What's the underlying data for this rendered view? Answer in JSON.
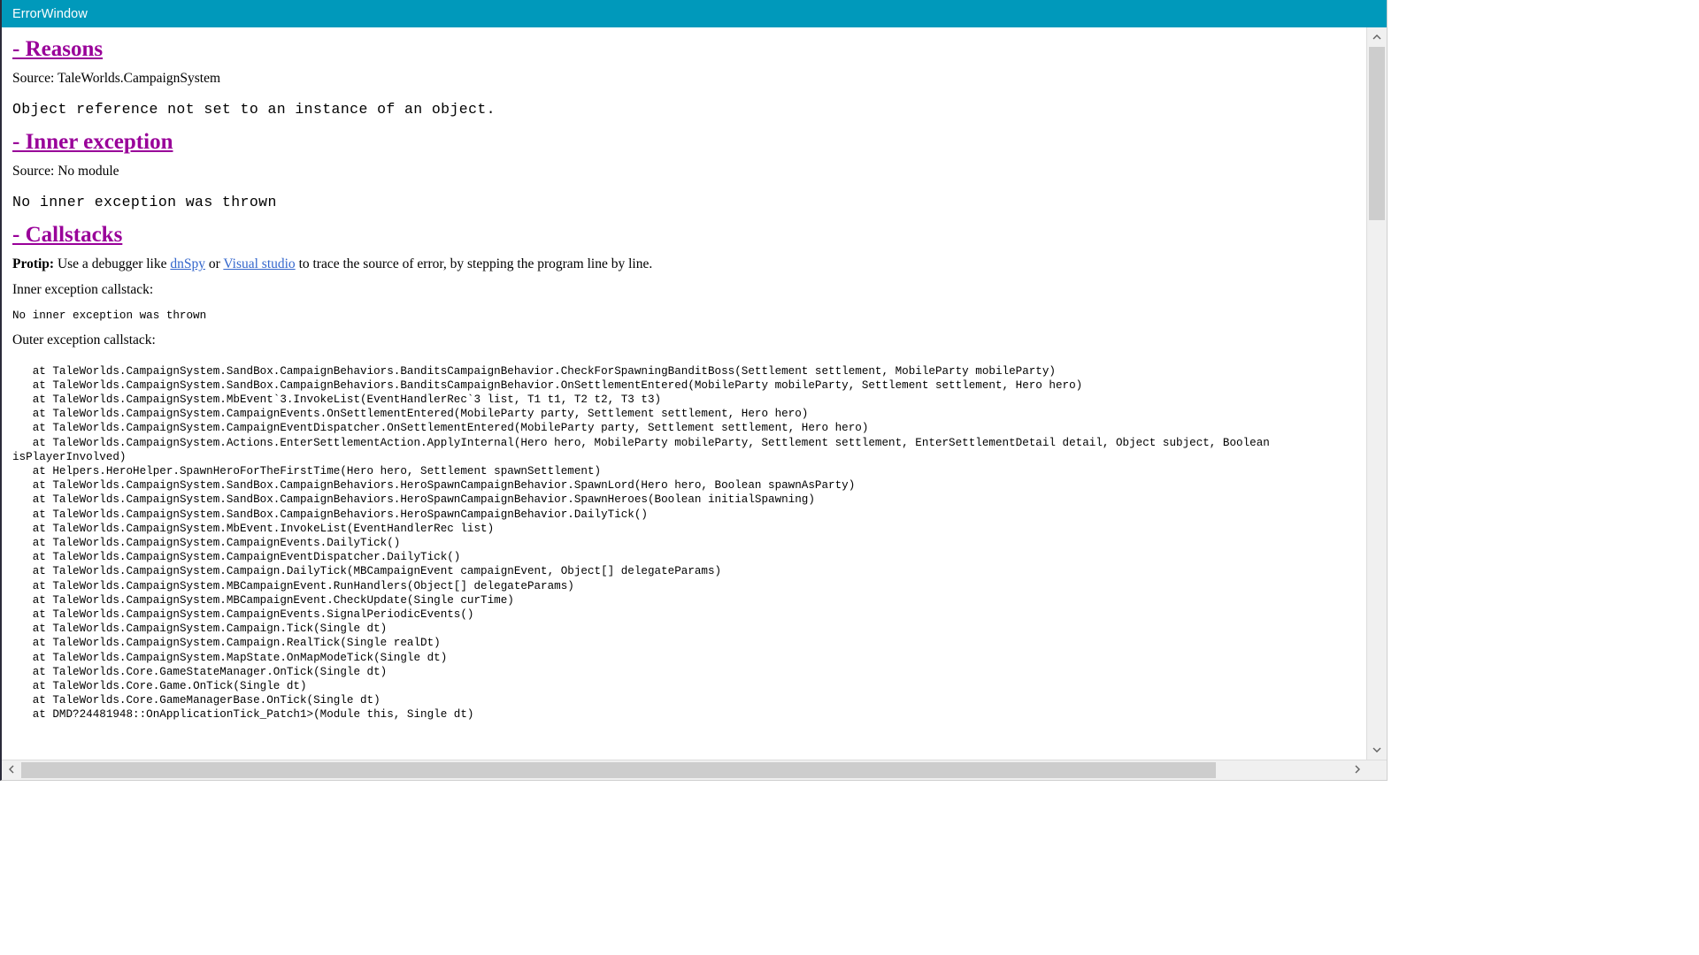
{
  "window": {
    "title": "ErrorWindow",
    "titlebar_color": "#0099bb",
    "heading_color": "#990099",
    "link_color": "#3366cc"
  },
  "sections": {
    "reasons": {
      "heading": "- Reasons",
      "source_line": "Source: TaleWorlds.CampaignSystem",
      "message": "Object reference not set to an instance of an object."
    },
    "inner_exception": {
      "heading": "- Inner exception",
      "source_line": "Source: No module",
      "message": "No inner exception was thrown"
    },
    "callstacks": {
      "heading": "- Callstacks",
      "protip_label": "Protip:",
      "protip_before": " Use a debugger like ",
      "link_dnspy": "dnSpy",
      "protip_or": " or ",
      "link_visual_studio": "Visual studio",
      "protip_after": " to trace the source of error, by stepping the program line by line.",
      "inner_label": "Inner exception callstack:",
      "inner_stack": "No inner exception was thrown",
      "outer_label": "Outer exception callstack:",
      "outer_stack_lines": [
        "   at TaleWorlds.CampaignSystem.SandBox.CampaignBehaviors.BanditsCampaignBehavior.CheckForSpawningBanditBoss(Settlement settlement, MobileParty mobileParty)",
        "   at TaleWorlds.CampaignSystem.SandBox.CampaignBehaviors.BanditsCampaignBehavior.OnSettlementEntered(MobileParty mobileParty, Settlement settlement, Hero hero)",
        "   at TaleWorlds.CampaignSystem.MbEvent`3.InvokeList(EventHandlerRec`3 list, T1 t1, T2 t2, T3 t3)",
        "   at TaleWorlds.CampaignSystem.CampaignEvents.OnSettlementEntered(MobileParty party, Settlement settlement, Hero hero)",
        "   at TaleWorlds.CampaignSystem.CampaignEventDispatcher.OnSettlementEntered(MobileParty party, Settlement settlement, Hero hero)",
        "   at TaleWorlds.CampaignSystem.Actions.EnterSettlementAction.ApplyInternal(Hero hero, MobileParty mobileParty, Settlement settlement, EnterSettlementDetail detail, Object subject, Boolean isPlayerInvolved)",
        "   at Helpers.HeroHelper.SpawnHeroForTheFirstTime(Hero hero, Settlement spawnSettlement)",
        "   at TaleWorlds.CampaignSystem.SandBox.CampaignBehaviors.HeroSpawnCampaignBehavior.SpawnLord(Hero hero, Boolean spawnAsParty)",
        "   at TaleWorlds.CampaignSystem.SandBox.CampaignBehaviors.HeroSpawnCampaignBehavior.SpawnHeroes(Boolean initialSpawning)",
        "   at TaleWorlds.CampaignSystem.SandBox.CampaignBehaviors.HeroSpawnCampaignBehavior.DailyTick()",
        "   at TaleWorlds.CampaignSystem.MbEvent.InvokeList(EventHandlerRec list)",
        "   at TaleWorlds.CampaignSystem.CampaignEvents.DailyTick()",
        "   at TaleWorlds.CampaignSystem.CampaignEventDispatcher.DailyTick()",
        "   at TaleWorlds.CampaignSystem.Campaign.DailyTick(MBCampaignEvent campaignEvent, Object[] delegateParams)",
        "   at TaleWorlds.CampaignSystem.MBCampaignEvent.RunHandlers(Object[] delegateParams)",
        "   at TaleWorlds.CampaignSystem.MBCampaignEvent.CheckUpdate(Single curTime)",
        "   at TaleWorlds.CampaignSystem.CampaignEvents.SignalPeriodicEvents()",
        "   at TaleWorlds.CampaignSystem.Campaign.Tick(Single dt)",
        "   at TaleWorlds.CampaignSystem.Campaign.RealTick(Single realDt)",
        "   at TaleWorlds.CampaignSystem.MapState.OnMapModeTick(Single dt)",
        "   at TaleWorlds.Core.GameStateManager.OnTick(Single dt)",
        "   at TaleWorlds.Core.Game.OnTick(Single dt)",
        "   at TaleWorlds.Core.GameManagerBase.OnTick(Single dt)",
        "   at DMD?24481948::OnApplicationTick_Patch1>(Module this, Single dt)"
      ]
    }
  },
  "scrollbars": {
    "vertical": {
      "up_arrow": "chevron-up-icon",
      "down_arrow": "chevron-down-icon"
    },
    "horizontal": {
      "left_arrow": "chevron-left-icon",
      "right_arrow": "chevron-right-icon"
    }
  }
}
